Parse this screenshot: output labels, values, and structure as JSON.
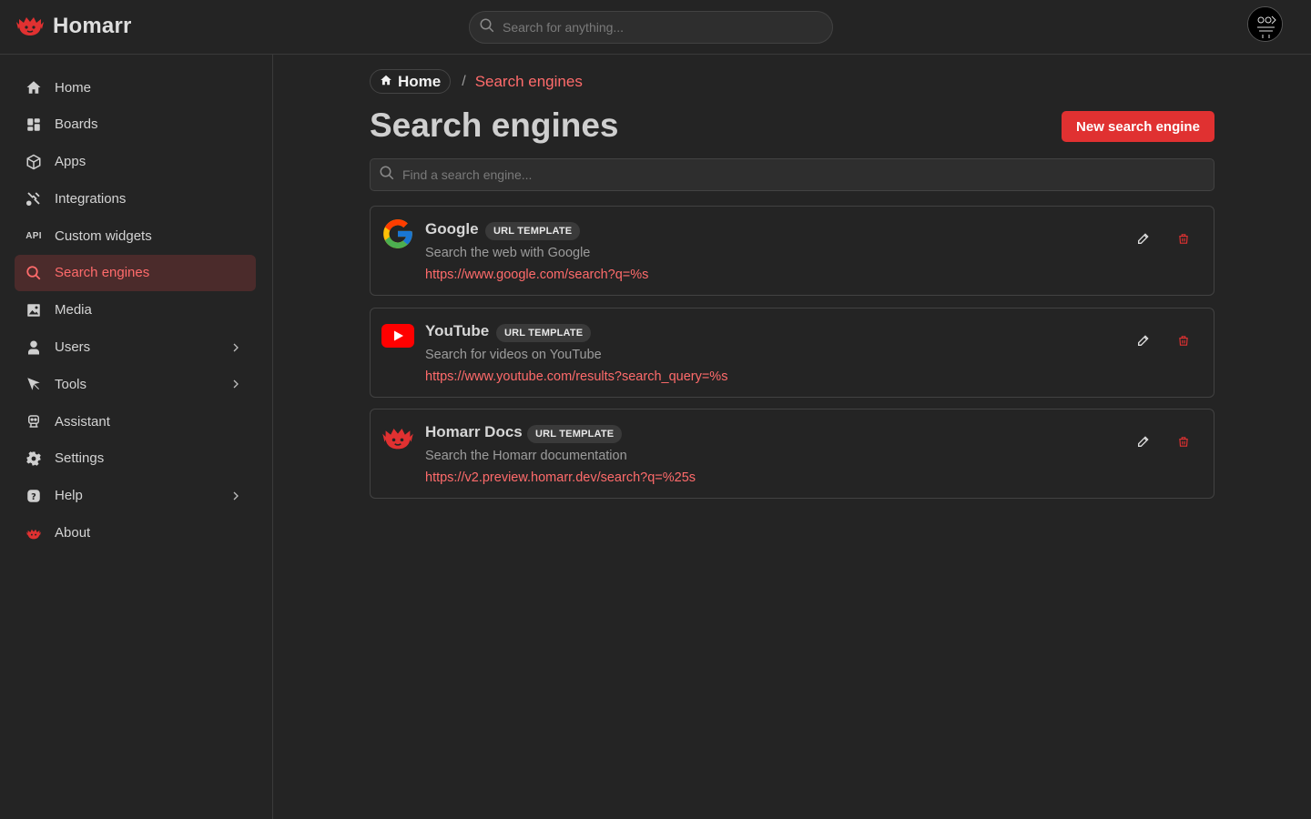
{
  "app": {
    "title": "Homarr"
  },
  "header": {
    "search_placeholder": "Search for anything..."
  },
  "sidebar": {
    "items": [
      {
        "label": "Home",
        "icon": "home-icon"
      },
      {
        "label": "Boards",
        "icon": "layout-grid-icon"
      },
      {
        "label": "Apps",
        "icon": "box-icon"
      },
      {
        "label": "Integrations",
        "icon": "plug-icon"
      },
      {
        "label": "Custom widgets",
        "icon": "api-icon"
      },
      {
        "label": "Search engines",
        "icon": "search-icon",
        "active": true
      },
      {
        "label": "Media",
        "icon": "photo-icon"
      },
      {
        "label": "Users",
        "icon": "user-icon",
        "has_children": true
      },
      {
        "label": "Tools",
        "icon": "tools-icon",
        "has_children": true
      },
      {
        "label": "Assistant",
        "icon": "robot-icon"
      },
      {
        "label": "Settings",
        "icon": "gear-icon"
      },
      {
        "label": "Help",
        "icon": "help-icon",
        "has_children": true
      },
      {
        "label": "About",
        "icon": "homarr-logo-icon"
      }
    ]
  },
  "breadcrumb": {
    "home": "Home",
    "separator": "/",
    "current": "Search engines"
  },
  "page": {
    "title": "Search engines",
    "new_button": "New search engine",
    "search_placeholder": "Find a search engine..."
  },
  "engines": [
    {
      "name": "Google",
      "badge": "URL TEMPLATE",
      "description": "Search the web with Google",
      "url": "https://www.google.com/search?q=%s",
      "logo": "google-logo"
    },
    {
      "name": "YouTube",
      "badge": "URL TEMPLATE",
      "description": "Search for videos on YouTube",
      "url": "https://www.youtube.com/results?search_query=%s",
      "logo": "youtube-logo"
    },
    {
      "name": "Homarr Docs",
      "badge": "URL TEMPLATE",
      "description": "Search the Homarr documentation",
      "url": "https://v2.preview.homarr.dev/search?q=%25s",
      "logo": "homarr-logo"
    }
  ],
  "colors": {
    "accent": "#e03131",
    "accent_text": "#ff6b6b",
    "background": "#242424",
    "active_bg": "#4b2b2b"
  }
}
